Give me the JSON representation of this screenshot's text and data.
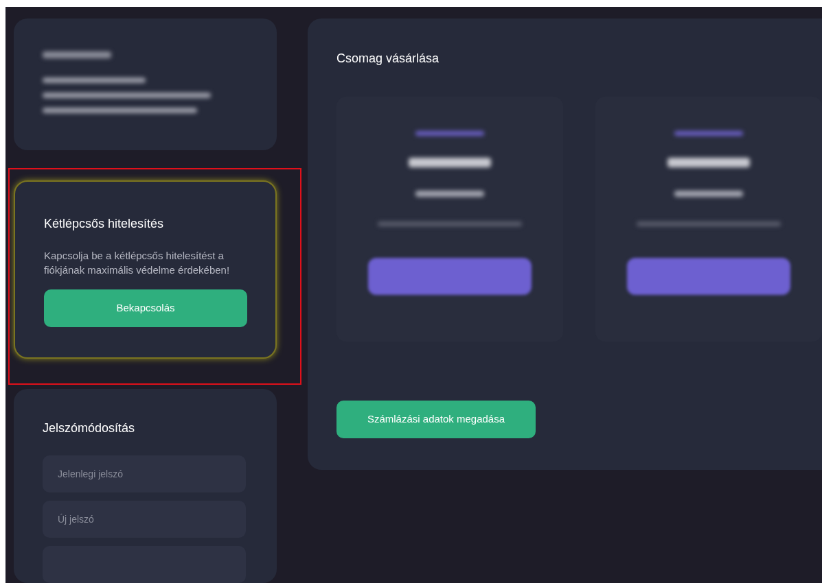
{
  "account_card": {
    "kind": "blurred"
  },
  "two_factor": {
    "title": "Kétlépcsős hitelesítés",
    "text": "Kapcsolja be a kétlépcsős hitelesítést a fiókjának maximális védelme érdekében!",
    "button": "Bekapcsolás",
    "highlighted": true
  },
  "password_change": {
    "title": "Jelszómódosítás",
    "fields": [
      {
        "kind": "input",
        "placeholder": "Jelenlegi jelszó"
      },
      {
        "kind": "input",
        "placeholder": "Új jelszó"
      },
      {
        "kind": "input"
      }
    ]
  },
  "purchase": {
    "title": "Csomag vásárlása",
    "packages": [
      {
        "kind": "blurred"
      },
      {
        "kind": "blurred"
      }
    ],
    "button": "Számlázási adatok megadása"
  }
}
